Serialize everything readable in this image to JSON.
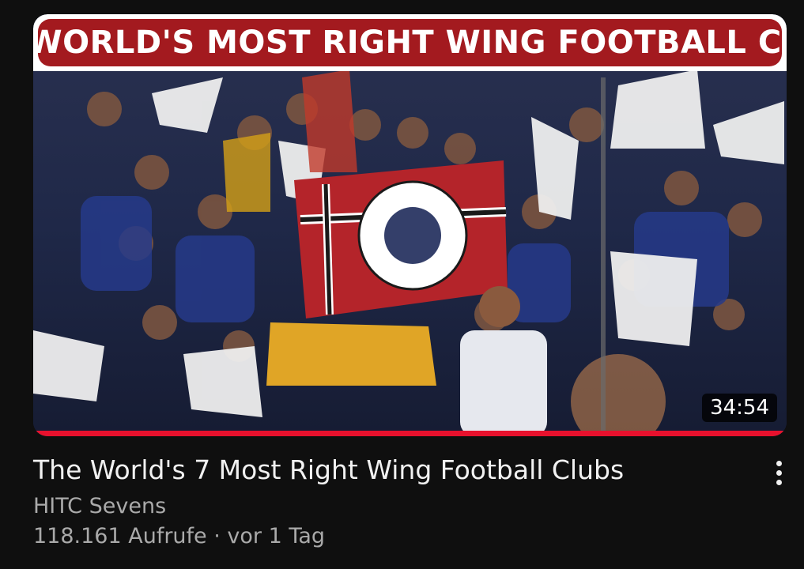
{
  "video": {
    "thumbnail_banner": "The World's Most Right Wing Football Clubs",
    "duration": "34:54",
    "watch_progress": 1.0,
    "title": "The World's 7 Most Right Wing Football Clubs",
    "channel": "HITC Sevens",
    "views": "118.161 Aufrufe",
    "separator": " · ",
    "age": "vor 1 Tag"
  },
  "icons": {
    "more": "three-dots-vertical-icon"
  },
  "colors": {
    "background": "#0f0f0f",
    "banner_red": "#a31a1f",
    "progress_red": "#e8112d",
    "title_text": "#f1f1f1",
    "secondary_text": "#aaaaaa"
  }
}
